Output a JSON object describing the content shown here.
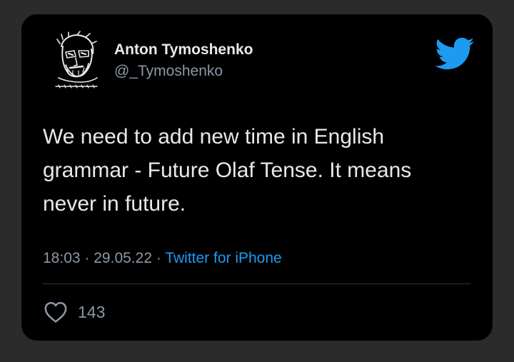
{
  "tweet": {
    "author": {
      "name": "Anton Tymoshenko",
      "handle": "@_Tymoshenko",
      "avatar_icon": "sketched-face-avatar"
    },
    "brand_icon": "twitter-bird-icon",
    "text": "We need to add new time in English grammar - Future Olaf Tense. It means never in future.",
    "time": "18:03",
    "date": "29.05.22",
    "separator": "·",
    "source": "Twitter for iPhone",
    "likes_icon": "heart-icon",
    "likes_count": "143"
  },
  "colors": {
    "background": "#2b2b2b",
    "card": "#000000",
    "text": "#e7e9ea",
    "muted": "#8b98a5",
    "accent": "#1d9bf0"
  }
}
